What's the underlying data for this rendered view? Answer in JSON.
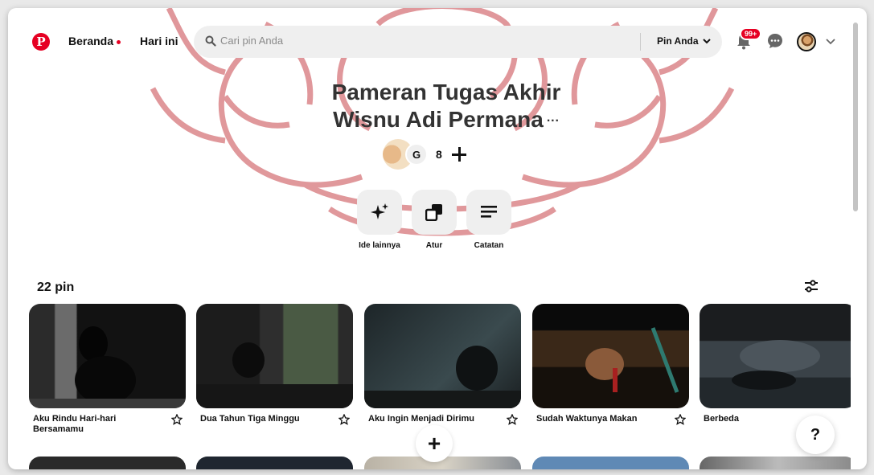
{
  "header": {
    "logo": "P",
    "nav_home": "Beranda",
    "nav_today": "Hari ini",
    "search_placeholder": "Cari pin Anda",
    "pin_filter": "Pin Anda",
    "notification_badge": "99+"
  },
  "board": {
    "title_line1": "Pameran Tugas Akhir",
    "title_line2": "Wisnu Adi Permana",
    "more": "···",
    "collaborator_initial": "G",
    "collaborator_count": "8"
  },
  "actions": [
    {
      "label": "Ide lainnya",
      "icon": "sparkle-icon"
    },
    {
      "label": "Atur",
      "icon": "organize-icon"
    },
    {
      "label": "Catatan",
      "icon": "notes-icon"
    }
  ],
  "pin_count": "22 pin",
  "pins": [
    {
      "title": "Aku Rindu Hari-hari Bersamamu"
    },
    {
      "title": "Dua Tahun Tiga Minggu"
    },
    {
      "title": "Aku Ingin Menjadi Dirimu"
    },
    {
      "title": "Sudah Waktunya Makan"
    },
    {
      "title": "Berbeda"
    }
  ],
  "fab": {
    "add": "+",
    "help": "?"
  },
  "colors": {
    "brand": "#e60023",
    "surface": "#efefef"
  }
}
